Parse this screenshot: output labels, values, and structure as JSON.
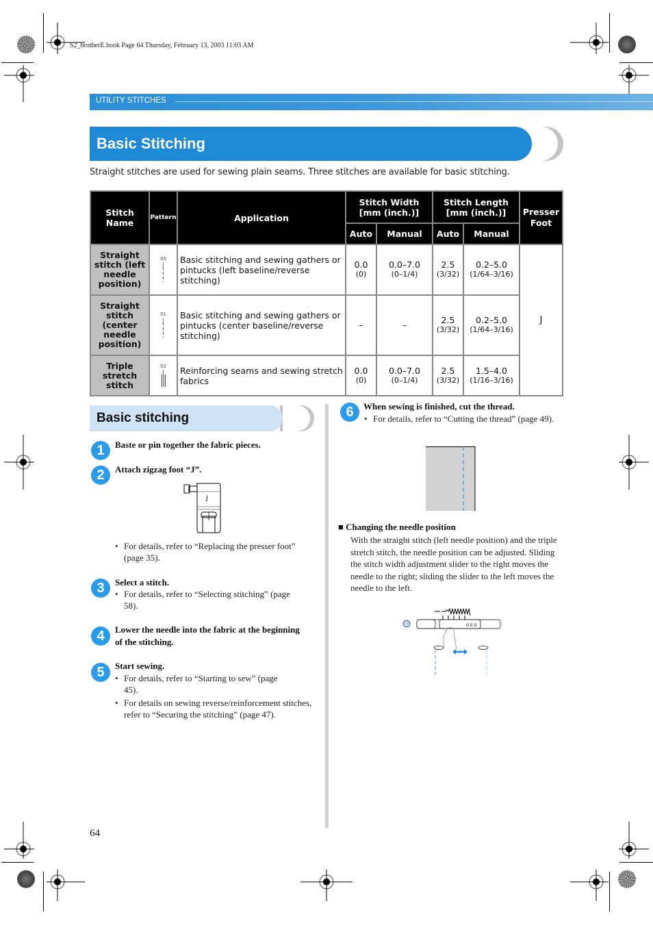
{
  "file_header": "S2_brotherE.book  Page 64  Thursday, February 13, 2003  11:03 AM",
  "section": {
    "label": "UTILITY STITCHES"
  },
  "title": "Basic Stitching",
  "intro": "Straight stitches are used for sewing plain seams. Three stitches are available for basic stitching.",
  "colors": {
    "accent_blue": "#1e8ad6",
    "step_blue": "#2a9be8",
    "subhead_bg": "#cfe3f6",
    "name_cell_bg": "#bfbfbf"
  },
  "table": {
    "headers": {
      "stitch_name": "Stitch Name",
      "pattern": "Pattern",
      "application": "Application",
      "stitch_width": "Stitch Width",
      "stitch_length": "Stitch Length",
      "unit": "[mm (inch.)]",
      "presser_foot": "Presser Foot",
      "auto": "Auto",
      "manual": "Manual"
    },
    "presser_foot_value": "J",
    "rows": [
      {
        "name": "Straight stitch (left needle position)",
        "pattern_number": "00",
        "pattern_foot": "J",
        "application": "Basic stitching and sewing gathers or pintucks (left baseline/reverse stitching)",
        "width_auto": "0.0",
        "width_auto_inch": "(0)",
        "width_manual": "0.0–7.0",
        "width_manual_inch": "(0–1/4)",
        "length_auto": "2.5",
        "length_auto_inch": "(3/32)",
        "length_manual": "0.2–5.0",
        "length_manual_inch": "(1/64–3/16)"
      },
      {
        "name": "Straight stitch (center needle position)",
        "pattern_number": "01",
        "pattern_foot": "J",
        "application": "Basic stitching and sewing gathers or pintucks (center baseline/reverse stitching)",
        "width_auto": "–",
        "width_auto_inch": "",
        "width_manual": "–",
        "width_manual_inch": "",
        "length_auto": "2.5",
        "length_auto_inch": "(3/32)",
        "length_manual": "0.2–5.0",
        "length_manual_inch": "(1/64–3/16)"
      },
      {
        "name": "Triple stretch stitch",
        "pattern_number": "02",
        "pattern_foot": "J",
        "application": "Reinforcing seams and sewing stretch fabrics",
        "width_auto": "0.0",
        "width_auto_inch": "(0)",
        "width_manual": "0.0–7.0",
        "width_manual_inch": "(0–1/4)",
        "length_auto": "2.5",
        "length_auto_inch": "(3/32)",
        "length_manual": "1.5–4.0",
        "length_manual_inch": "(1/16–3/16)"
      }
    ]
  },
  "subheading": "Basic stitching",
  "steps": [
    {
      "number": "1",
      "title": "Baste or pin together the fabric pieces.",
      "bullets": []
    },
    {
      "number": "2",
      "title": "Attach zigzag foot “J”.",
      "foot_label": "J",
      "bullets": [
        "For details, refer to “Replacing the presser foot” (page 35)."
      ]
    },
    {
      "number": "3",
      "title": "Select a stitch.",
      "bullets": [
        "For details, refer to “Selecting stitching” (page 58)."
      ]
    },
    {
      "number": "4",
      "title": "Lower the needle into the fabric at the beginning of the stitching.",
      "bullets": []
    },
    {
      "number": "5",
      "title": "Start sewing.",
      "bullets": [
        "For details, refer to “Starting to sew” (page 45).",
        "For details on sewing reverse/reinforcement stitches, refer to “Securing the stitching” (page 47)."
      ]
    },
    {
      "number": "6",
      "title": "When sewing is finished, cut the thread.",
      "bullets": [
        "For details, refer to “Cutting the thread” (page 49)."
      ]
    }
  ],
  "note": {
    "heading": "Changing the needle position",
    "body": "With the straight stitch (left needle position) and the triple stretch stitch, the needle position can be adjusted. Sliding the stitch width adjustment slider to the right moves the needle to the right; sliding the slider to the left moves the needle to the left."
  },
  "page_number": "64"
}
